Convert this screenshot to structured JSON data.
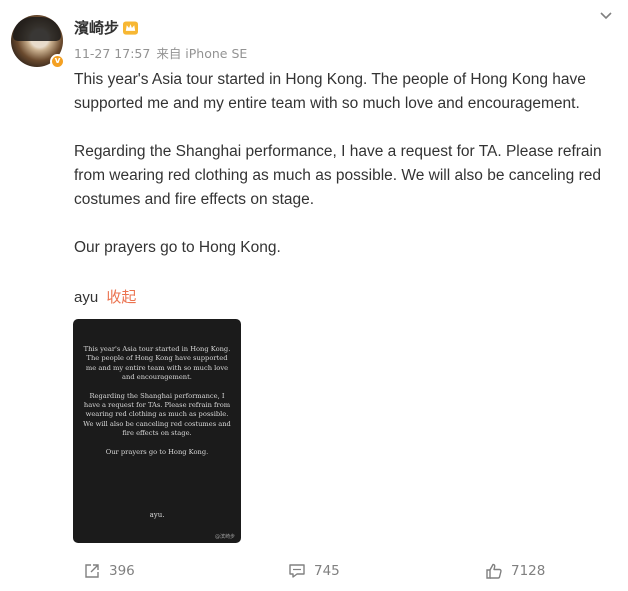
{
  "post": {
    "author": "濱崎步",
    "timestamp": "11-27 17:57",
    "source": "来自 iPhone SE",
    "paragraphs": [
      "This year's Asia tour started in Hong Kong. The people of Hong Kong have supported me and my entire team with so much love and encouragement.",
      "Regarding the Shanghai performance, I have a request for TA. Please refrain from wearing red clothing as much as possible. We will also be canceling red costumes and fire effects on stage.",
      "Our prayers go to Hong Kong."
    ],
    "signature": "ayu",
    "collapse_label": "收起"
  },
  "image": {
    "paragraphs": [
      "This year's Asia tour started in Hong Kong. The people of Hong Kong have supported me and my entire team with so much love and encouragement.",
      "Regarding the Shanghai performance, I have a request for TAs. Please refrain from wearing red clothing as much as possible. We will also be canceling red costumes and fire effects on stage.",
      "Our prayers go to Hong Kong."
    ],
    "signature": "ayu.",
    "watermark": "@滨崎步"
  },
  "actions": {
    "share_count": "396",
    "comment_count": "745",
    "like_count": "7128"
  },
  "colors": {
    "accent": "#eb7350",
    "verified": "#f4a022",
    "text": "#333333",
    "muted": "#939393"
  }
}
